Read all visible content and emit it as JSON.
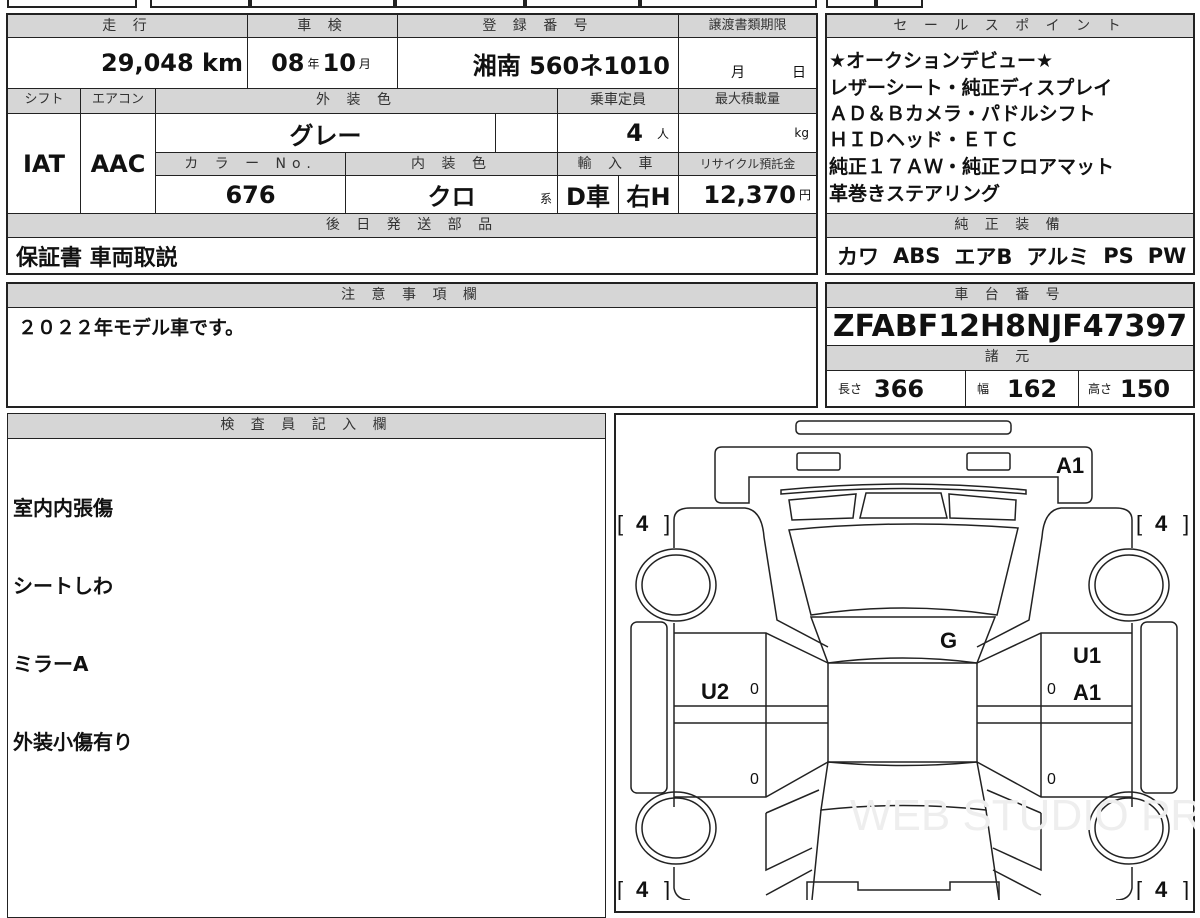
{
  "basic": {
    "mileage_label": "走 行",
    "mileage": "29,048",
    "mileage_unit": "km",
    "inspection_label": "車 検",
    "inspection_year": "08",
    "year_unit": "年",
    "inspection_month": "10",
    "month_unit": "月",
    "registration_label": "登 録 番 号",
    "registration": "湘南 560ネ1010",
    "transfer_label": "譲渡書類期限",
    "transfer_month": "月",
    "transfer_day": "日",
    "shift_label": "シフト",
    "shift": "IAT",
    "ac_label": "エアコン",
    "ac": "AAC",
    "exterior_label": "外 装 色",
    "exterior": "グレー",
    "capacity_label": "乗車定員",
    "capacity": "4",
    "capacity_unit": "人",
    "max_load_label": "最大積載量",
    "max_load_unit": "kg",
    "color_no_label": "カ ラ ー No.",
    "color_no": "676",
    "interior_label": "内 装 色",
    "interior": "クロ",
    "interior_suffix": "系",
    "import_label": "輸 入 車",
    "import_type": "D車",
    "handle": "右H",
    "recycle_label": "リサイクル預託金",
    "recycle": "12,370",
    "recycle_unit": "円",
    "later_parts_label": "後 日 発 送 部 品",
    "later_parts": "保証書 車両取説"
  },
  "sales_points": {
    "label": "セ ー ル ス ポ イ ン ト",
    "lines": [
      "★オークションデビュー★",
      "レザーシート・純正ディスプレイ",
      "ＡＤ＆Ｂカメラ・パドルシフト",
      "ＨＩＤヘッド・ＥＴＣ",
      "純正１７ＡＷ・純正フロアマット",
      "革巻きステアリング"
    ]
  },
  "equipment": {
    "label": "純 正 装 備",
    "items": [
      "カワ",
      "ABS",
      "エアB",
      "アルミ",
      "PS",
      "PW"
    ]
  },
  "notes": {
    "label": "注 意 事 項 欄",
    "text": "２０２２年モデル車です。"
  },
  "chassis": {
    "label": "車 台 番 号",
    "number": "ZFABF12H8NJF47397",
    "spec_label": "諸 元",
    "length_label": "長さ",
    "length": "366",
    "width_label": "幅",
    "width": "162",
    "height_label": "高さ",
    "height": "150"
  },
  "inspector": {
    "label": "検 査 員 記 入 欄",
    "lines": [
      "室内内張傷",
      "シートしわ",
      "ミラーA",
      "外装小傷有り"
    ]
  },
  "diagram": {
    "marks": {
      "rear": "A1",
      "roof": "G",
      "left_door": "U2",
      "right_door_1": "U1",
      "right_door_2": "A1"
    },
    "tires": [
      "4",
      "4",
      "4",
      "4"
    ],
    "zero": "0",
    "watermark": "WEB STUDIO PRO"
  }
}
